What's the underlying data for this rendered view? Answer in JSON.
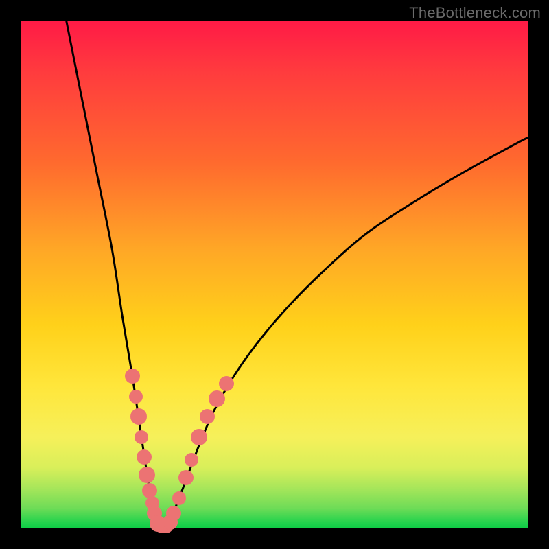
{
  "watermark": "TheBottleneck.com",
  "colors": {
    "frame": "#000000",
    "marker": "#ec7373",
    "curve": "#000000",
    "gradient_stops": [
      "#ff1a46",
      "#ff3b3e",
      "#ff6a2e",
      "#ffa726",
      "#ffd11a",
      "#ffe63b",
      "#f6f05a",
      "#d9ef5a",
      "#a8e65a",
      "#6edc57",
      "#1fd24c",
      "#0ecc45"
    ]
  },
  "chart_data": {
    "type": "line",
    "title": "",
    "xlabel": "",
    "ylabel": "",
    "xlim": [
      0,
      100
    ],
    "ylim": [
      0,
      100
    ],
    "series": [
      {
        "name": "bottleneck-curve",
        "x": [
          9,
          12,
          15,
          18,
          20,
          22,
          23.5,
          25,
          26,
          27,
          28.5,
          30,
          32,
          35,
          38,
          42,
          47,
          53,
          60,
          68,
          77,
          87,
          98,
          100
        ],
        "y": [
          100,
          85,
          70,
          55,
          42,
          30,
          20,
          10,
          4,
          0,
          0.5,
          3,
          8,
          16,
          23,
          30,
          37,
          44,
          51,
          58,
          64,
          70,
          76,
          77
        ]
      }
    ],
    "left_markers": {
      "note": "salmon dotted markers on left descending branch (x,y in 0–100 space, r in px)",
      "points": [
        {
          "x": 22.0,
          "y": 30.0,
          "r": 11
        },
        {
          "x": 22.7,
          "y": 26.0,
          "r": 10
        },
        {
          "x": 23.2,
          "y": 22.0,
          "r": 12
        },
        {
          "x": 23.8,
          "y": 18.0,
          "r": 10
        },
        {
          "x": 24.3,
          "y": 14.0,
          "r": 11
        },
        {
          "x": 24.9,
          "y": 10.5,
          "r": 12
        },
        {
          "x": 25.4,
          "y": 7.5,
          "r": 11
        },
        {
          "x": 25.9,
          "y": 5.0,
          "r": 10
        },
        {
          "x": 26.4,
          "y": 3.0,
          "r": 11
        }
      ]
    },
    "bottom_markers": {
      "note": "markers along valley floor",
      "points": [
        {
          "x": 27.0,
          "y": 1.0,
          "r": 12
        },
        {
          "x": 27.8,
          "y": 0.5,
          "r": 11
        },
        {
          "x": 28.6,
          "y": 0.6,
          "r": 11
        },
        {
          "x": 29.4,
          "y": 1.2,
          "r": 11
        }
      ]
    },
    "right_markers": {
      "note": "markers on right ascending branch",
      "points": [
        {
          "x": 30.2,
          "y": 3.0,
          "r": 11
        },
        {
          "x": 31.2,
          "y": 6.0,
          "r": 10
        },
        {
          "x": 32.5,
          "y": 10.0,
          "r": 11
        },
        {
          "x": 33.6,
          "y": 13.5,
          "r": 10
        },
        {
          "x": 35.2,
          "y": 18.0,
          "r": 12
        },
        {
          "x": 36.8,
          "y": 22.0,
          "r": 11
        },
        {
          "x": 38.6,
          "y": 25.5,
          "r": 12
        },
        {
          "x": 40.5,
          "y": 28.5,
          "r": 11
        }
      ]
    }
  }
}
